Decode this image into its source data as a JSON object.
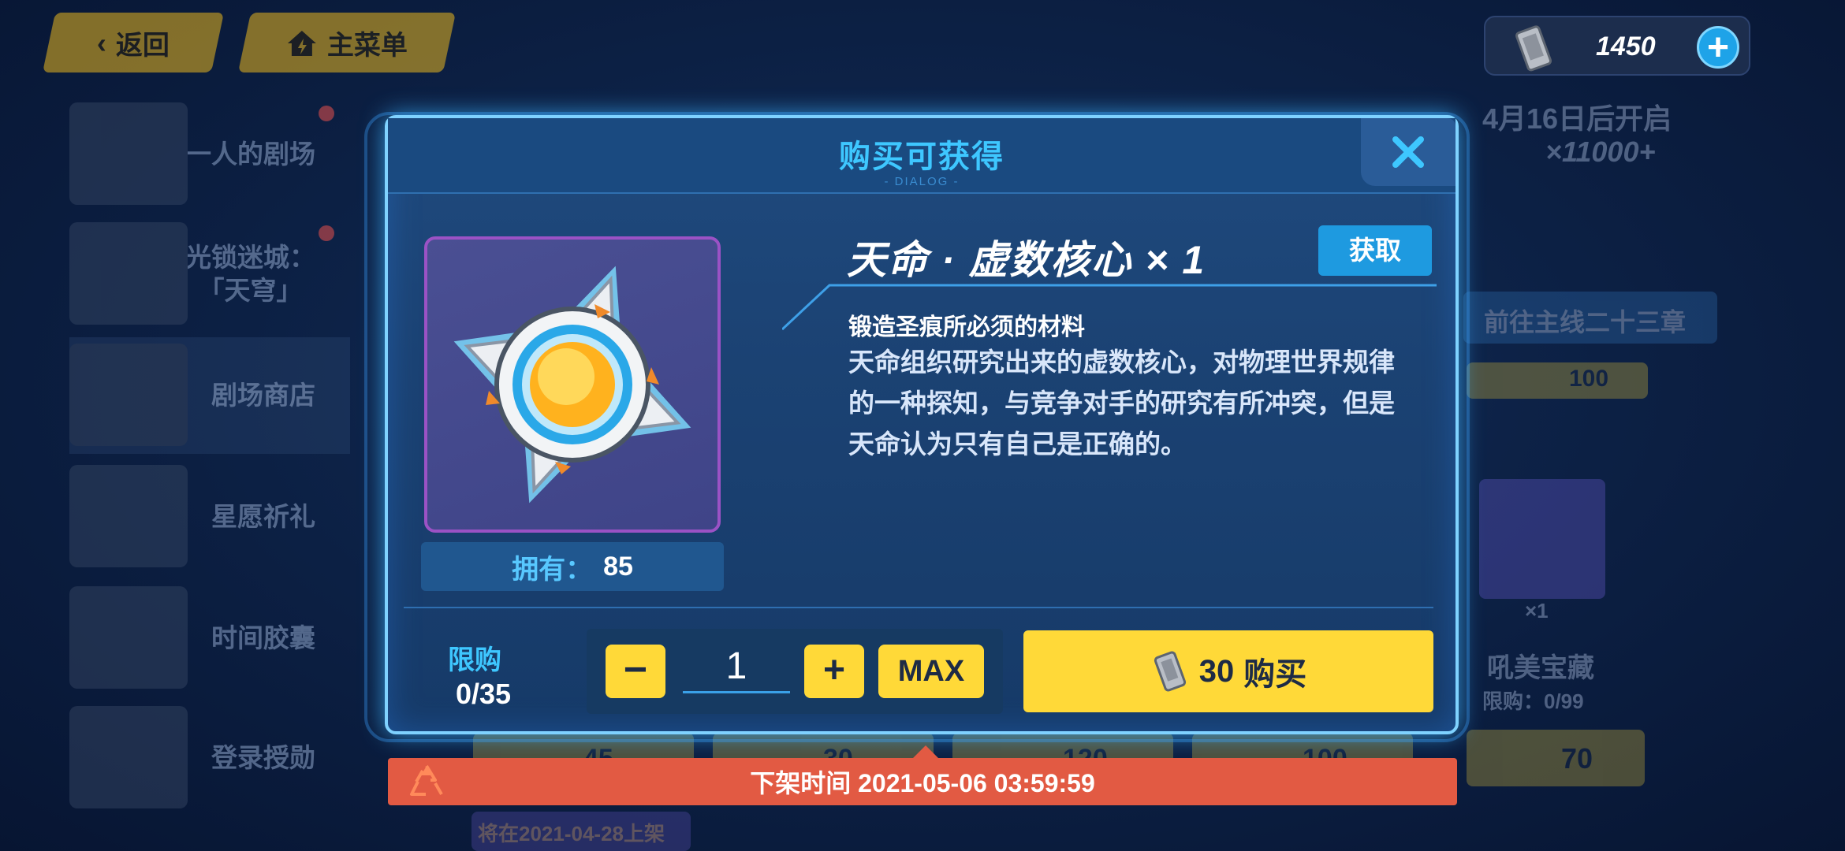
{
  "topbar": {
    "back_label": "返回",
    "main_menu_label": "主菜单",
    "currency_value": "1450",
    "currency_icon": "crystal-ticket-icon",
    "add_icon": "plus-icon"
  },
  "sidebar": {
    "items": [
      {
        "label": "一人的剧场",
        "has_dot": true
      },
      {
        "label": "光锁迷城：\n「天穹」",
        "has_dot": true
      },
      {
        "label": "剧场商店",
        "active": true
      },
      {
        "label": "星愿祈礼"
      },
      {
        "label": "时间胶囊"
      },
      {
        "label": "登录授勋"
      }
    ]
  },
  "background": {
    "banner_text": "4月16日后开启",
    "bonus_text": "×11000+",
    "chapter_button": "前往主线二十三章",
    "item_name": "吼美宝藏",
    "item_count": "×1",
    "item_limit": "限购：0/99",
    "item_price": "70",
    "row_prices": [
      "45",
      "30",
      "120",
      "100"
    ],
    "prev_price": "100",
    "upcoming_text": "将在2021-04-28上架"
  },
  "dialog": {
    "title": "购买可获得",
    "subtitle": "- DIALOG -",
    "close_icon": "close-icon",
    "item_icon": "honkai-core-icon",
    "item_name": "天命 · 虚数核心 × 1",
    "get_label": "获取",
    "owned_label": "拥有：",
    "owned_value": "85",
    "desc_title": "锻造圣痕所必须的材料",
    "desc_body": "天命组织研究出来的虚数核心，对物理世界规律的一种探知，与竞争对手的研究有所冲突，但是天命认为只有自己是正确的。",
    "limit_label": "限购",
    "limit_value": "0/35",
    "minus_label": "−",
    "quantity": "1",
    "plus_label": "+",
    "max_label": "MAX",
    "price": "30",
    "buy_label": "购买",
    "colors": {
      "accent": "#3ec7ff",
      "button": "#ffd938",
      "alert": "#e25a43"
    }
  },
  "footer": {
    "recycle_icon": "recycle-icon",
    "deadline_text": "下架时间 2021-05-06 03:59:59"
  }
}
